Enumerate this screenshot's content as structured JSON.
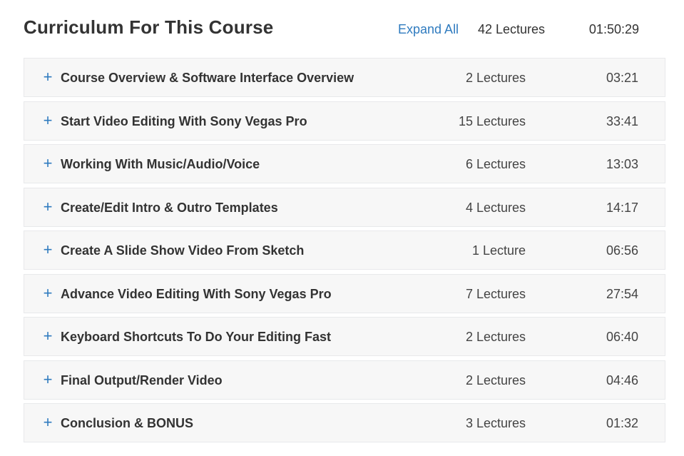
{
  "header": {
    "title": "Curriculum For This Course",
    "expand_all_label": "Expand All",
    "total_lectures": "42 Lectures",
    "total_duration": "01:50:29"
  },
  "icons": {
    "expand": "plus-icon"
  },
  "colors": {
    "accent": "#2f7bbf",
    "row_background": "#f7f7f7",
    "text": "#333333"
  },
  "sections": [
    {
      "title": "Course Overview & Software Interface Overview",
      "lectures": "2 Lectures",
      "duration": "03:21"
    },
    {
      "title": "Start Video Editing With Sony Vegas Pro",
      "lectures": "15 Lectures",
      "duration": "33:41"
    },
    {
      "title": "Working With Music/Audio/Voice",
      "lectures": "6 Lectures",
      "duration": "13:03"
    },
    {
      "title": "Create/Edit Intro & Outro Templates",
      "lectures": "4 Lectures",
      "duration": "14:17"
    },
    {
      "title": "Create A Slide Show Video From Sketch",
      "lectures": "1 Lecture",
      "duration": "06:56"
    },
    {
      "title": "Advance Video Editing With Sony Vegas Pro",
      "lectures": "7 Lectures",
      "duration": "27:54"
    },
    {
      "title": "Keyboard Shortcuts To Do Your Editing Fast",
      "lectures": "2 Lectures",
      "duration": "06:40"
    },
    {
      "title": "Final Output/Render Video",
      "lectures": "2 Lectures",
      "duration": "04:46"
    },
    {
      "title": "Conclusion & BONUS",
      "lectures": "3 Lectures",
      "duration": "01:32"
    }
  ]
}
